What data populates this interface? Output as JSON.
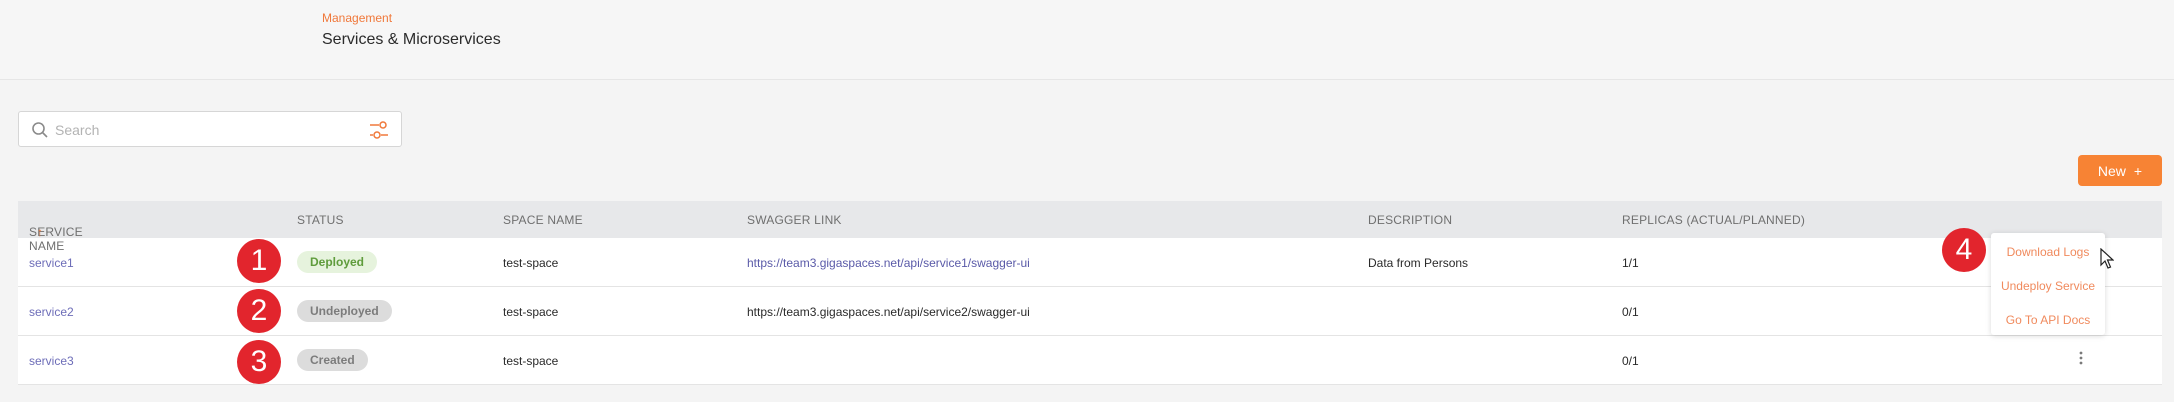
{
  "header": {
    "breadcrumb": "Management",
    "title": "Services & Microservices"
  },
  "search": {
    "placeholder": "Search",
    "icon": "search-icon",
    "filter_icon": "filter-settings-icon"
  },
  "toolbar": {
    "new_label": "New",
    "new_icon": "+"
  },
  "table": {
    "columns": {
      "service_name": "SERVICE NAME",
      "status": "STATUS",
      "space_name": "SPACE NAME",
      "swagger_link": "SWAGGER LINK",
      "description": "DESCRIPTION",
      "replicas": "REPLICAS (ACTUAL/PLANNED)"
    },
    "sort_indicator": "↑",
    "rows": [
      {
        "name": "service1",
        "status": "Deployed",
        "space": "test-space",
        "swagger": "https://team3.gigaspaces.net/api/service1/swagger-ui",
        "description": "Data from Persons",
        "replicas": "1/1"
      },
      {
        "name": "service2",
        "status": "Undeployed",
        "space": "test-space",
        "swagger": "https://team3.gigaspaces.net/api/service2/swagger-ui",
        "description": "",
        "replicas": "0/1"
      },
      {
        "name": "service3",
        "status": "Created",
        "space": "test-space",
        "swagger": "",
        "description": "",
        "replicas": "0/1"
      }
    ]
  },
  "markers": [
    "1",
    "2",
    "3",
    "4"
  ],
  "context_menu": {
    "items": [
      "Download Logs",
      "Undeploy Service",
      "Go To API Docs"
    ]
  },
  "colors": {
    "accent": "#f78334",
    "marker": "#e2252d",
    "deployed": "#5f9c3c",
    "link": "#6d6db8"
  }
}
